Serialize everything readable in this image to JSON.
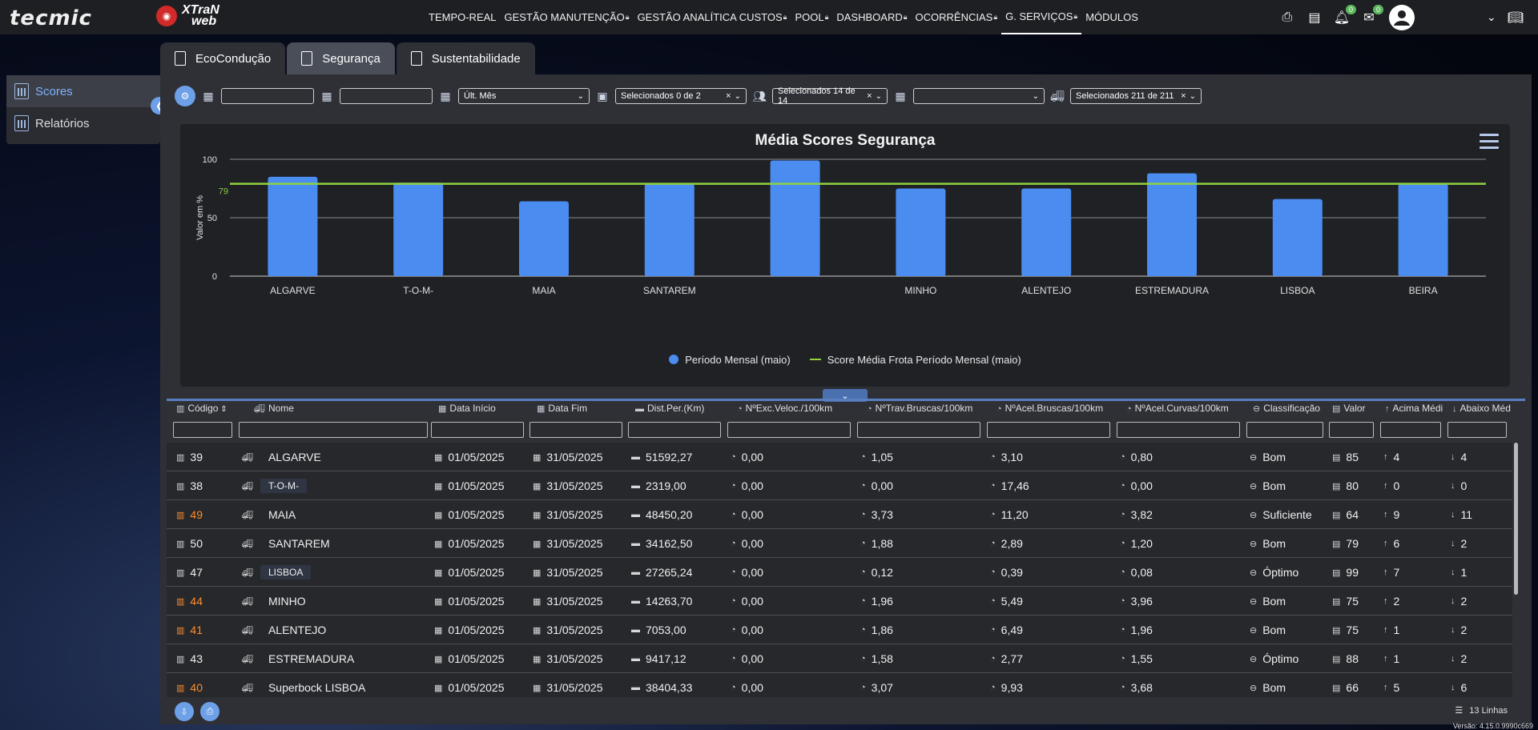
{
  "brand": {
    "tecmic": "tecmic",
    "xtran_top": "XTraN",
    "xtran_bottom": "web"
  },
  "nav": [
    {
      "label": "TEMPO-REAL",
      "locked": false,
      "active": false
    },
    {
      "label": "GESTÃO MANUTENÇÃO",
      "locked": true,
      "active": false
    },
    {
      "label": "GESTÃO ANALÍTICA CUSTOS",
      "locked": true,
      "active": false
    },
    {
      "label": "POOL",
      "locked": true,
      "active": false
    },
    {
      "label": "DASHBOARD",
      "locked": true,
      "active": false
    },
    {
      "label": "OCORRÊNCIAS",
      "locked": true,
      "active": false
    },
    {
      "label": "G. SERVIÇOS",
      "locked": true,
      "active": true
    },
    {
      "label": "MÓDULOS",
      "locked": false,
      "active": false
    }
  ],
  "topbar": {
    "notifications_count": "0",
    "messages_count": "0"
  },
  "side": {
    "items": [
      "Scores",
      "Relatórios"
    ]
  },
  "tabs": [
    "EcoCondução",
    "Segurança",
    "Sustentabilidade"
  ],
  "filters": {
    "period": "Últ. Mês",
    "group1": "Selecionados 0 de 2",
    "group2": "Selecionados 14 de 14",
    "vehicles": "Selecionados 211 de 211"
  },
  "chart_data": {
    "type": "bar",
    "title": "Média Scores Segurança",
    "ylabel": "Valor em %",
    "ylim": [
      0,
      100
    ],
    "yticks": [
      0,
      50,
      100
    ],
    "categories": [
      "ALGARVE",
      "T-O-M-",
      "MAIA",
      "SANTAREM",
      "",
      "MINHO",
      "ALENTEJO",
      "ESTREMADURA",
      "LISBOA",
      "BEIRA"
    ],
    "series": [
      {
        "name": "Período Mensal (maio)",
        "values": [
          85,
          80,
          64,
          79,
          99,
          75,
          75,
          88,
          66,
          79
        ],
        "color": "#4a8cf0"
      }
    ],
    "reference_line": {
      "name": "Score Média Frota Período Mensal (maio)",
      "value": 79,
      "label": "79",
      "color": "#8fd13f"
    },
    "grid": true,
    "legend": "bottom-center"
  },
  "table": {
    "headers": [
      "Código",
      "Nome",
      "Data Início",
      "Data Fim",
      "Dist.Per.(Km)",
      "NºExc.Veloc./100km",
      "NºTrav.Bruscas/100km",
      "NºAcel.Bruscas/100km",
      "NºAcel.Curvas/100km",
      "Classificação",
      "Valor",
      "Acima Médi",
      "Abaixo Méd"
    ],
    "rows": [
      {
        "code": "39",
        "orange": false,
        "name": "ALGARVE",
        "boxed": false,
        "start": "01/05/2025",
        "end": "31/05/2025",
        "dist": "51592,27",
        "exc": "0,00",
        "trav": "1,05",
        "acel": "3,10",
        "curv": "0,80",
        "class": "Bom",
        "valor": "85",
        "acima": "4",
        "abaixo": "4"
      },
      {
        "code": "38",
        "orange": false,
        "name": "T-O-M-",
        "boxed": true,
        "start": "01/05/2025",
        "end": "31/05/2025",
        "dist": "2319,00",
        "exc": "0,00",
        "trav": "0,00",
        "acel": "17,46",
        "curv": "0,00",
        "class": "Bom",
        "valor": "80",
        "acima": "0",
        "abaixo": "0"
      },
      {
        "code": "49",
        "orange": true,
        "name": "MAIA",
        "boxed": false,
        "start": "01/05/2025",
        "end": "31/05/2025",
        "dist": "48450,20",
        "exc": "0,00",
        "trav": "3,73",
        "acel": "11,20",
        "curv": "3,82",
        "class": "Suficiente",
        "valor": "64",
        "acima": "9",
        "abaixo": "11"
      },
      {
        "code": "50",
        "orange": false,
        "name": "SANTAREM",
        "boxed": false,
        "start": "01/05/2025",
        "end": "31/05/2025",
        "dist": "34162,50",
        "exc": "0,00",
        "trav": "1,88",
        "acel": "2,89",
        "curv": "1,20",
        "class": "Bom",
        "valor": "79",
        "acima": "6",
        "abaixo": "2"
      },
      {
        "code": "47",
        "orange": false,
        "name": "LISBOA",
        "boxed": true,
        "start": "01/05/2025",
        "end": "31/05/2025",
        "dist": "27265,24",
        "exc": "0,00",
        "trav": "0,12",
        "acel": "0,39",
        "curv": "0,08",
        "class": "Óptimo",
        "valor": "99",
        "acima": "7",
        "abaixo": "1"
      },
      {
        "code": "44",
        "orange": true,
        "name": "MINHO",
        "boxed": false,
        "start": "01/05/2025",
        "end": "31/05/2025",
        "dist": "14263,70",
        "exc": "0,00",
        "trav": "1,96",
        "acel": "5,49",
        "curv": "3,96",
        "class": "Bom",
        "valor": "75",
        "acima": "2",
        "abaixo": "2"
      },
      {
        "code": "41",
        "orange": true,
        "name": "ALENTEJO",
        "boxed": false,
        "start": "01/05/2025",
        "end": "31/05/2025",
        "dist": "7053,00",
        "exc": "0,00",
        "trav": "1,86",
        "acel": "6,49",
        "curv": "1,96",
        "class": "Bom",
        "valor": "75",
        "acima": "1",
        "abaixo": "2"
      },
      {
        "code": "43",
        "orange": false,
        "name": "ESTREMADURA",
        "boxed": false,
        "start": "01/05/2025",
        "end": "31/05/2025",
        "dist": "9417,12",
        "exc": "0,00",
        "trav": "1,58",
        "acel": "2,77",
        "curv": "1,55",
        "class": "Óptimo",
        "valor": "88",
        "acima": "1",
        "abaixo": "2"
      },
      {
        "code": "40",
        "orange": true,
        "name": "Superbock LISBOA",
        "boxed": false,
        "start": "01/05/2025",
        "end": "31/05/2025",
        "dist": "38404,33",
        "exc": "0,00",
        "trav": "3,07",
        "acel": "9,93",
        "curv": "3,68",
        "class": "Bom",
        "valor": "66",
        "acima": "5",
        "abaixo": "6"
      }
    ]
  },
  "footer": {
    "lines": "13 Linhas",
    "version": "Versão: 4.15.0.9990c669"
  }
}
